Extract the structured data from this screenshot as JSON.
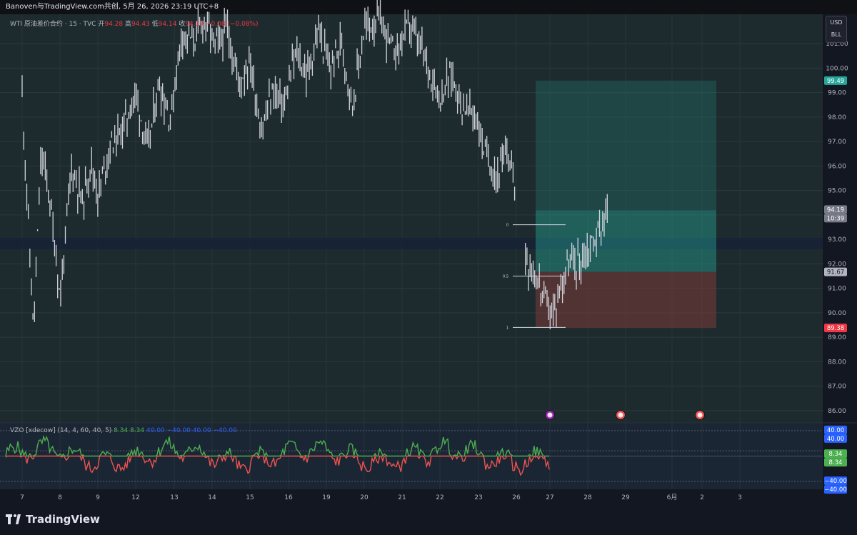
{
  "header": {
    "text": "Banoven与TradingView.com共创, 5月 26, 2026 23:19 UTC+8"
  },
  "legend": {
    "title": "WTI 原油差价合约 · 15 · TVC",
    "open_label": "开",
    "open": "94.28",
    "high_label": "高",
    "high": "94.43",
    "low_label": "低",
    "low": "94.14",
    "close_label": "收",
    "close": "94.19",
    "change": "−0.08 (−0.08%)"
  },
  "indicator": {
    "name": "VZO [xdecow] (14, 4, 60, 40, 5)",
    "values": [
      "8.34",
      "8.34",
      "40.00",
      "−40.00",
      "40.00",
      "−40.00"
    ]
  },
  "unit": {
    "currency": "USD",
    "unit": "BLL"
  },
  "price_badges": {
    "take_profit": "99.49",
    "current": "94.19",
    "countdown": "10:39",
    "entry": "91.67",
    "stop": "89.38",
    "vzo_up_1": "40.00",
    "vzo_up_2": "40.00",
    "vzo_val_1": "8.34",
    "vzo_val_2": "8.34",
    "vzo_dn_1": "−40.00",
    "vzo_dn_2": "−40.00"
  },
  "colors": {
    "bg": "#1e2b2e",
    "up": "#4caf50",
    "down": "#ef5350",
    "teal": "#26a69a",
    "red": "#7e3a3a",
    "accent": "#2962ff"
  },
  "chart_data": {
    "type": "line",
    "ylim": [
      85.5,
      102.2
    ],
    "y_ticks": [
      86,
      87,
      88,
      89,
      90,
      91,
      92,
      93,
      94,
      95,
      96,
      97,
      98,
      99,
      100,
      101
    ],
    "x_ticks": [
      "7",
      "8",
      "9",
      "12",
      "13",
      "14",
      "15",
      "16",
      "19",
      "20",
      "21",
      "22",
      "23",
      "26",
      "27",
      "28",
      "29",
      "6月",
      "2",
      "3"
    ],
    "waypoints": [
      [
        7,
        98.9
      ],
      [
        7.3,
        89.2
      ],
      [
        7.5,
        96.5
      ],
      [
        7.7,
        95.0
      ],
      [
        7.9,
        92.2
      ],
      [
        8.0,
        90.5
      ],
      [
        8.3,
        96.0
      ],
      [
        8.6,
        94.5
      ],
      [
        8.8,
        96.2
      ],
      [
        9.0,
        94.8
      ],
      [
        9.3,
        96.8
      ],
      [
        9.6,
        97.4
      ],
      [
        10.0,
        99.0
      ],
      [
        10.3,
        96.6
      ],
      [
        10.6,
        99.4
      ],
      [
        10.9,
        97.9
      ],
      [
        11.2,
        101.5
      ],
      [
        11.5,
        101.1
      ],
      [
        11.8,
        102.0
      ],
      [
        12.1,
        100.9
      ],
      [
        12.4,
        101.6
      ],
      [
        12.7,
        99.4
      ],
      [
        13.0,
        100.3
      ],
      [
        13.3,
        97.4
      ],
      [
        13.6,
        99.1
      ],
      [
        13.9,
        98.5
      ],
      [
        14.2,
        100.6
      ],
      [
        14.5,
        99.7
      ],
      [
        14.8,
        101.5
      ],
      [
        15.1,
        99.9
      ],
      [
        15.4,
        101.1
      ],
      [
        15.7,
        98.5
      ],
      [
        16.0,
        101.6
      ],
      [
        16.4,
        102.0
      ],
      [
        16.8,
        100.6
      ],
      [
        17.2,
        101.8
      ],
      [
        17.6,
        100.4
      ],
      [
        18.0,
        98.8
      ],
      [
        18.3,
        99.8
      ],
      [
        18.6,
        98.4
      ],
      [
        18.9,
        98.2
      ],
      [
        19.2,
        96.5
      ],
      [
        19.5,
        95.6
      ],
      [
        19.8,
        96.6
      ],
      [
        20.0,
        94.9
      ],
      [
        20.2,
        92.5
      ],
      [
        20.5,
        91.5
      ],
      [
        20.8,
        90.4
      ],
      [
        21.0,
        89.9
      ],
      [
        21.3,
        91.9
      ],
      [
        21.6,
        92.0
      ],
      [
        21.9,
        92.6
      ],
      [
        22.2,
        93.4
      ],
      [
        22.4,
        94.2
      ]
    ],
    "position": {
      "take_profit": 99.49,
      "entry": 91.67,
      "stop": 89.38,
      "current": 94.19
    },
    "fib_levels": [
      {
        "label": "0",
        "price": 93.6
      },
      {
        "label": "0.5",
        "price": 91.5
      },
      {
        "label": "1",
        "price": 89.4
      }
    ],
    "vzo": {
      "ylim": [
        -50,
        50
      ],
      "levels": [
        40,
        8.34,
        -40
      ]
    }
  }
}
